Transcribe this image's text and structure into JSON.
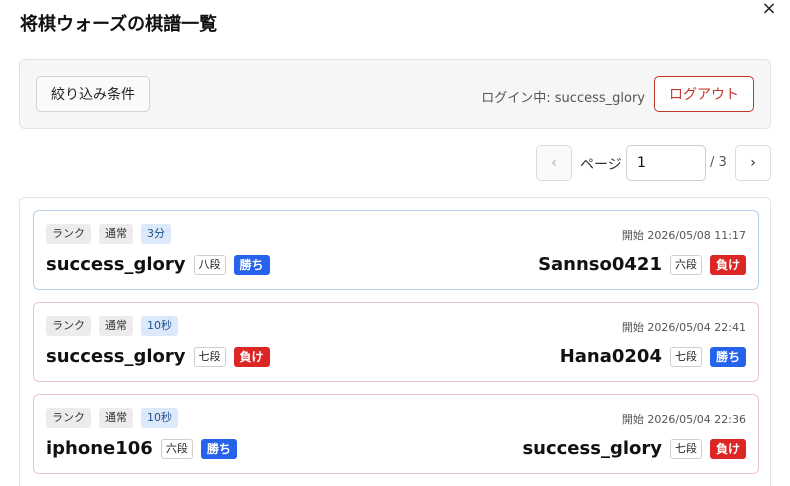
{
  "dialog": {
    "title": "将棋ウォーズの棋譜一覧",
    "close_label": "×"
  },
  "filter": {
    "button_label": "絞り込み条件",
    "login_text": "ログイン中: success_glory",
    "logout_label": "ログアウト"
  },
  "pager": {
    "prev": "‹",
    "label": "ページ",
    "current": "1",
    "total": "/ 3",
    "next": "›"
  },
  "games": [
    {
      "tags": [
        "ランク",
        "通常",
        "3分"
      ],
      "start": "開始 2026/05/08 11:17",
      "left": {
        "name": "success_glory",
        "rank": "八段",
        "result": "勝ち"
      },
      "right": {
        "name": "Sannso0421",
        "rank": "六段",
        "result": "負け"
      }
    },
    {
      "tags": [
        "ランク",
        "通常",
        "10秒"
      ],
      "start": "開始 2026/05/04 22:41",
      "left": {
        "name": "success_glory",
        "rank": "七段",
        "result": "負け"
      },
      "right": {
        "name": "Hana0204",
        "rank": "七段",
        "result": "勝ち"
      }
    },
    {
      "tags": [
        "ランク",
        "通常",
        "10秒"
      ],
      "start": "開始 2026/05/04 22:36",
      "left": {
        "name": "iphone106",
        "rank": "六段",
        "result": "勝ち"
      },
      "right": {
        "name": "success_glory",
        "rank": "七段",
        "result": "負け"
      }
    }
  ],
  "colors": {
    "win": "#2563eb",
    "lose": "#dc2626",
    "logout": "#c0392b"
  }
}
